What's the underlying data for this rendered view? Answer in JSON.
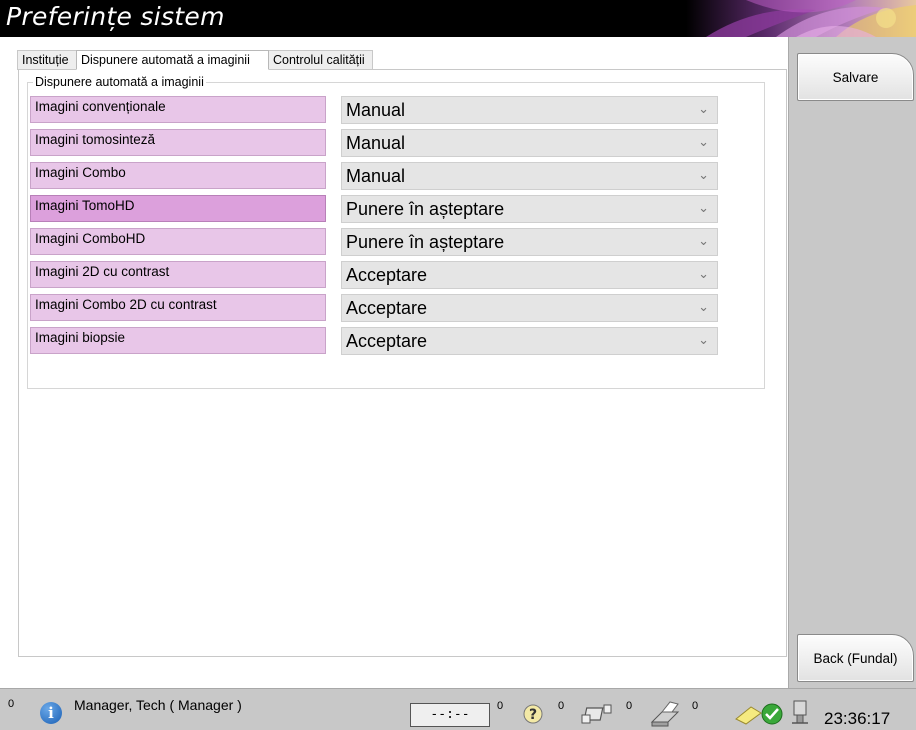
{
  "window": {
    "title": "Preferințe sistem"
  },
  "tabs": [
    {
      "label": "Instituție",
      "active": false
    },
    {
      "label": "Dispunere automată a imaginii",
      "active": true
    },
    {
      "label": "Controlul calității",
      "active": false
    }
  ],
  "group": {
    "legend": "Dispunere automată a imaginii"
  },
  "rows": [
    {
      "label": "Imagini convenționale",
      "value": "Manual"
    },
    {
      "label": "Imagini tomosinteză",
      "value": "Manual"
    },
    {
      "label": "Imagini Combo",
      "value": "Manual"
    },
    {
      "label": "Imagini TomoHD",
      "value": "Punere în așteptare",
      "highlighted": true
    },
    {
      "label": "Imagini ComboHD",
      "value": "Punere în așteptare"
    },
    {
      "label": "Imagini 2D cu contrast",
      "value": "Acceptare"
    },
    {
      "label": "Imagini Combo 2D cu contrast",
      "value": "Acceptare"
    },
    {
      "label": "Imagini biopsie",
      "value": "Acceptare"
    }
  ],
  "sidebar": {
    "save_label": "Salvare",
    "back_label": "Back (Fundal)"
  },
  "status_bar": {
    "left_count": "0",
    "user": "Manager, Tech ( Manager )",
    "timer": "--:--",
    "counts": [
      "0",
      "0",
      "0",
      "0"
    ],
    "clock": "23:36:17"
  },
  "colors": {
    "label_bg": "#e8c6e8",
    "label_highlight_bg": "#dca0dc",
    "sidebar_bg": "#c8c8c8"
  },
  "icons": [
    "info-icon",
    "timer-icon",
    "help-icon",
    "network-icon",
    "printer-icon",
    "notes-icon",
    "check-icon",
    "usb-icon"
  ]
}
